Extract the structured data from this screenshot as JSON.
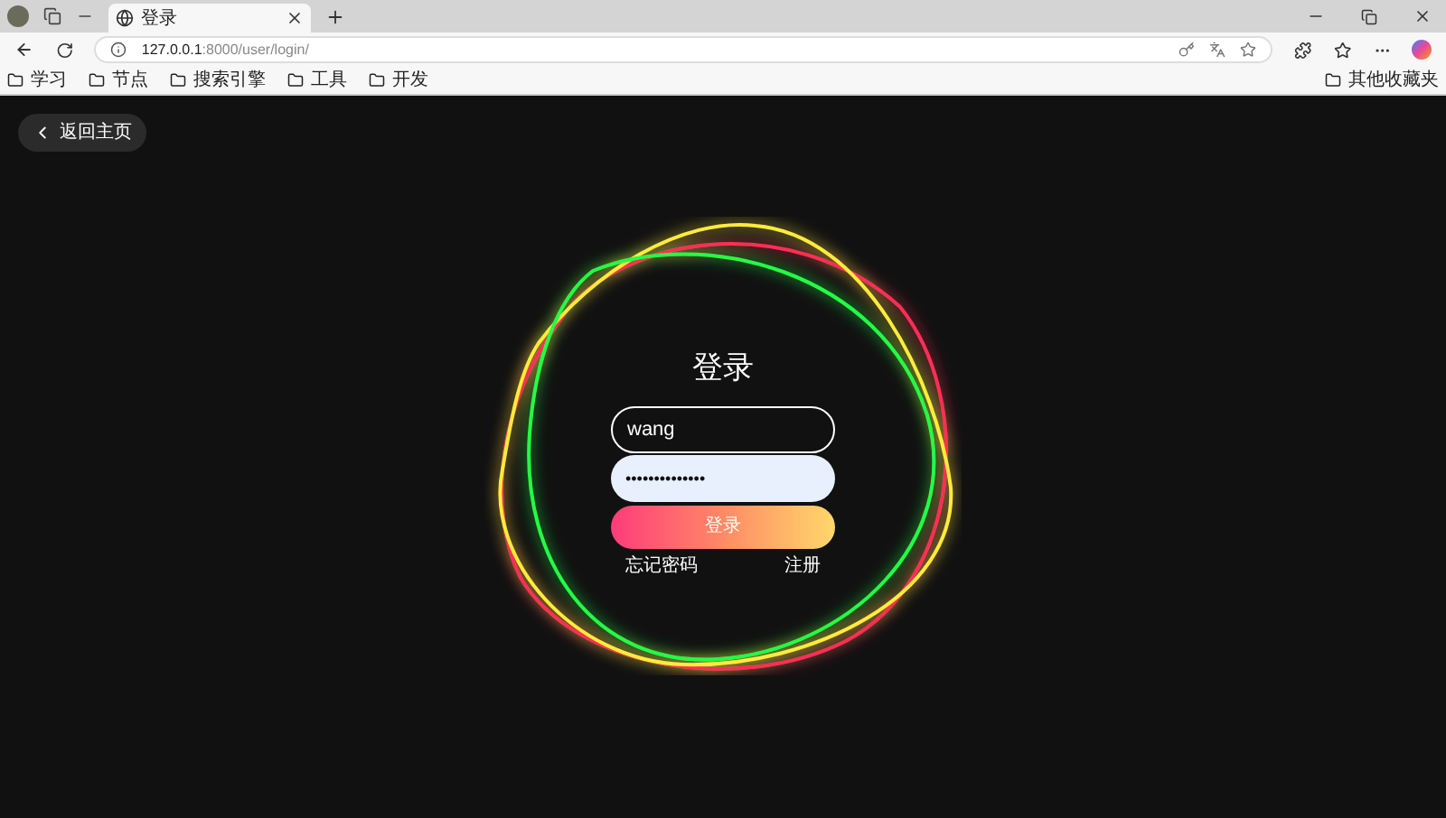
{
  "browser": {
    "tab": {
      "title": "登录"
    },
    "address": {
      "host": "127.0.0.1",
      "rest": ":8000/user/login/"
    },
    "bookmarks": [
      "学习",
      "节点",
      "搜索引擎",
      "工具",
      "开发"
    ],
    "other_bookmarks": "其他收藏夹"
  },
  "page": {
    "back_button": "返回主页",
    "title": "登录",
    "username": {
      "value": "wang"
    },
    "password": {
      "value": "••••••••••••••",
      "focused": true
    },
    "login_button": "登录",
    "forgot_link": "忘记密码",
    "register_link": "注册"
  }
}
